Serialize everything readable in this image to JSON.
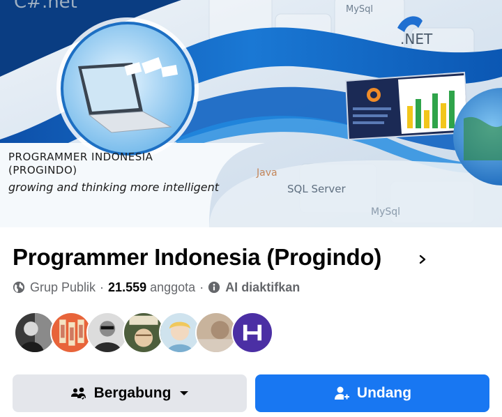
{
  "cover": {
    "title_line1": "PROGRAMMER INDONESIA",
    "title_line2": "(PROGINDO)",
    "tagline": "growing and thinking more intelligent",
    "bg_words": [
      "C#.net",
      "MySql",
      ".NET",
      "Java",
      "SQL Server",
      "MySql"
    ]
  },
  "group": {
    "name": "Programmer Indonesia (Progindo)",
    "privacy_icon": "globe-icon",
    "privacy": "Grup Publik",
    "separator": "·",
    "member_count": "21.559",
    "member_label": "anggota",
    "ai_icon": "info-icon",
    "ai_status": "AI diaktifkan"
  },
  "members": {
    "avatars": [
      {
        "desc": "avatar-member-1",
        "bg": "#3a3a3a"
      },
      {
        "desc": "avatar-member-2",
        "bg": "#e8643a"
      },
      {
        "desc": "avatar-member-3",
        "bg": "#4a4a4a"
      },
      {
        "desc": "avatar-member-4",
        "bg": "#b9a77f"
      },
      {
        "desc": "avatar-member-5",
        "bg": "#a6c6d9"
      },
      {
        "desc": "avatar-member-6",
        "bg": "#b9a08a"
      },
      {
        "desc": "avatar-member-7",
        "bg": "#4b2fa4",
        "letter": "H"
      }
    ]
  },
  "actions": {
    "join_label": "Bergabung",
    "join_icon": "group-icon",
    "invite_label": "Undang",
    "invite_icon": "add-person-icon"
  },
  "colors": {
    "primary": "#1877f2",
    "secondary_button": "#e4e6eb",
    "text_primary": "#050505",
    "text_secondary": "#65676b"
  }
}
